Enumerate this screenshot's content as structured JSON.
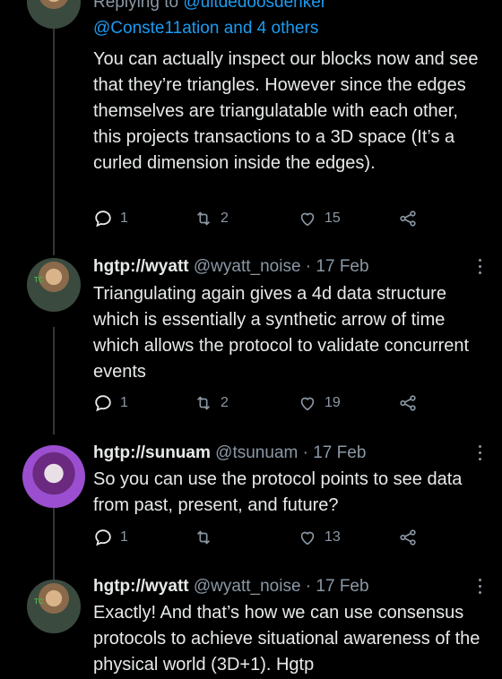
{
  "tweets": [
    {
      "reply_prefix": "Replying to",
      "reply_mention_top": "@ultdedoosdenker",
      "reply_mention": "@Conste11ation and 4 others",
      "text": "You can actually inspect our blocks now and see that they’re triangles. However since the edges themselves are triangulatable with each other, this projects transactions to a 3D space (It’s a curled dimension inside the edges).",
      "replies": "1",
      "retweets": "2",
      "likes": "15"
    },
    {
      "name": "hgtp://wyatt",
      "handle": "@wyatt_noise",
      "dot": "·",
      "date": "17 Feb",
      "avatar_mark": "TC",
      "text": "Triangulating again gives a 4d data structure which is essentially a synthetic arrow of time which allows the protocol to validate concurrent events",
      "replies": "1",
      "retweets": "2",
      "likes": "19"
    },
    {
      "name": "hgtp://sunuam",
      "handle": "@tsunuam",
      "dot": "·",
      "date": "17 Feb",
      "text": "So you can use the protocol points to see data from past, present, and future?",
      "replies": "1",
      "retweets": "",
      "likes": "13"
    },
    {
      "name": "hgtp://wyatt",
      "handle": "@wyatt_noise",
      "dot": "·",
      "date": "17 Feb",
      "avatar_mark": "TC",
      "text": "Exactly! And that’s how we can use consensus protocols to achieve situational awareness of the physical world (3D+1). Hgtp"
    }
  ],
  "icons": {
    "reply": "reply-icon",
    "retweet": "retweet-icon",
    "like": "heart-icon",
    "share": "share-icon",
    "more": "more-icon"
  },
  "colors": {
    "background": "#000000",
    "text": "#e7e9ea",
    "muted": "#8b98a5",
    "accent": "#1d9bf0"
  }
}
